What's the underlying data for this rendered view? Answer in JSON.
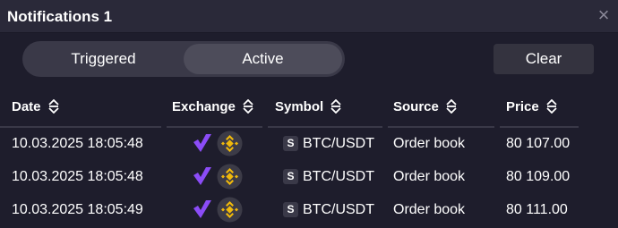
{
  "window": {
    "title": "Notifications 1",
    "close_glyph": "×"
  },
  "tabs": [
    {
      "label": "Triggered",
      "selected": false
    },
    {
      "label": "Active",
      "selected": true
    }
  ],
  "clear_label": "Clear",
  "columns": [
    {
      "key": "date",
      "label": "Date"
    },
    {
      "key": "exchange",
      "label": "Exchange"
    },
    {
      "key": "symbol",
      "label": "Symbol"
    },
    {
      "key": "source",
      "label": "Source"
    },
    {
      "key": "price",
      "label": "Price"
    }
  ],
  "rows": [
    {
      "date": "10.03.2025 18:05:48",
      "exchange_icons": [
        "purple-v-logo-icon",
        "binance-logo-icon"
      ],
      "symbol_badge": "S",
      "symbol": "BTC/USDT",
      "source": "Order book",
      "price": "80 107.00"
    },
    {
      "date": "10.03.2025 18:05:48",
      "exchange_icons": [
        "purple-v-logo-icon",
        "binance-logo-icon"
      ],
      "symbol_badge": "S",
      "symbol": "BTC/USDT",
      "source": "Order book",
      "price": "80 109.00"
    },
    {
      "date": "10.03.2025 18:05:49",
      "exchange_icons": [
        "purple-v-logo-icon",
        "binance-logo-icon"
      ],
      "symbol_badge": "S",
      "symbol": "BTC/USDT",
      "source": "Order book",
      "price": "80 111.00"
    }
  ],
  "colors": {
    "background": "#1e1d2c",
    "titlebar": "#2a2939",
    "accent_purple": "#8b4cf7",
    "binance_gold": "#f0b90b"
  }
}
